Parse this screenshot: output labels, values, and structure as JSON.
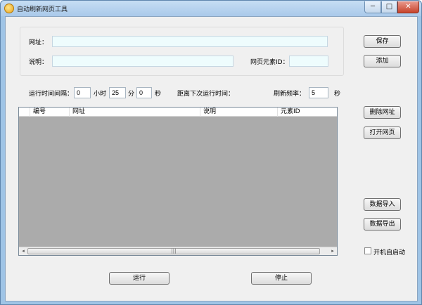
{
  "window": {
    "title": "自动刷新网页工具",
    "min_glyph": "─",
    "max_glyph": "□",
    "close_glyph": "✕"
  },
  "form": {
    "url_label": "网址：",
    "url_value": "",
    "desc_label": "说明：",
    "desc_value": "",
    "element_id_label": "网页元素ID：",
    "element_id_value": ""
  },
  "timing": {
    "interval_label": "运行时间间隔：",
    "hours_value": "0",
    "hours_unit": "小时",
    "minutes_value": "25",
    "minutes_unit": "分",
    "seconds_value": "0",
    "seconds_unit": "秒",
    "next_run_label": "距离下次运行时间：",
    "freq_label": "刷新频率：",
    "freq_value": "5",
    "freq_unit": "秒"
  },
  "table": {
    "columns": [
      "",
      "编号",
      "网址",
      "说明",
      "元素ID"
    ],
    "rows": [],
    "scroll_thumb_glyph": "|||",
    "left_arrow": "◂",
    "right_arrow": "▸"
  },
  "buttons": {
    "save": "保存",
    "add": "添加",
    "delete_url": "删除网址",
    "open_page": "打开网页",
    "import_data": "数据导入",
    "export_data": "数据导出",
    "run": "运行",
    "stop": "停止"
  },
  "autostart": {
    "label": "开机自启动",
    "checked": false
  }
}
